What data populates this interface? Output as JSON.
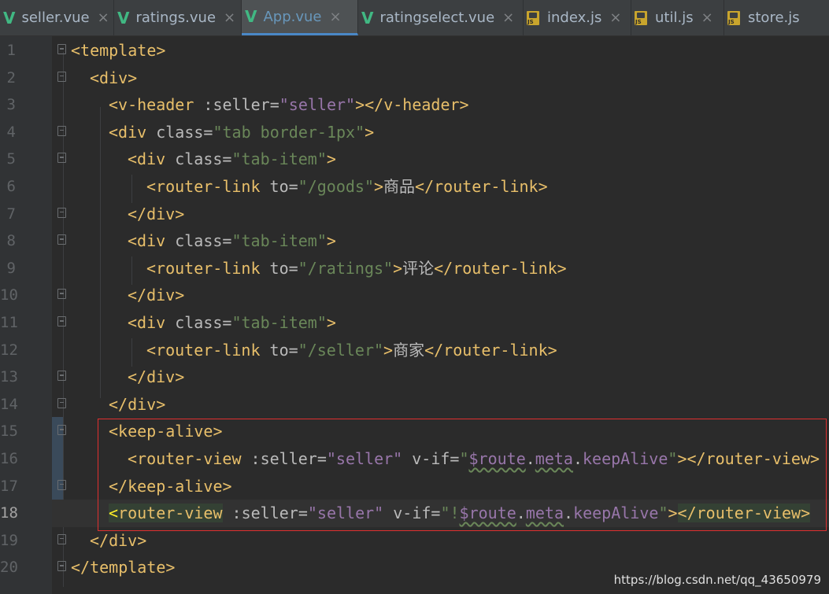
{
  "tabs": [
    {
      "label": "seller.vue",
      "icon": "vue-icon",
      "active": false
    },
    {
      "label": "ratings.vue",
      "icon": "vue-icon",
      "active": false
    },
    {
      "label": "App.vue",
      "icon": "vue-icon",
      "active": true
    },
    {
      "label": "ratingselect.vue",
      "icon": "vue-icon",
      "active": false
    },
    {
      "label": "index.js",
      "icon": "js-icon",
      "active": false
    },
    {
      "label": "util.js",
      "icon": "js-icon",
      "active": false
    },
    {
      "label": "store.js",
      "icon": "js-icon",
      "active": false
    }
  ],
  "close_glyph": "×",
  "vue_glyph": "V",
  "line_numbers": [
    "1",
    "2",
    "3",
    "4",
    "5",
    "6",
    "7",
    "8",
    "9",
    "10",
    "11",
    "12",
    "13",
    "14",
    "15",
    "16",
    "17",
    "18",
    "19",
    "20"
  ],
  "code": {
    "l1_tag": "<template>",
    "l2_tag": "<div>",
    "l3_open": "<v-header",
    "l3_attr": " :seller=",
    "l3_val": "\"seller\"",
    "l3_close": "></v-header>",
    "l4_open": "<div",
    "l4_attr": " class=",
    "l4_val": "\"tab border-1px\"",
    "l4_close": ">",
    "l5_open": "<div",
    "l5_attr": " class=",
    "l5_val": "\"tab-item\"",
    "l5_close": ">",
    "l6_open": "<router-link",
    "l6_attr": " to=",
    "l6_val": "\"/goods\"",
    "l6_gt": ">",
    "l6_text": "商品",
    "l6_close": "</router-link>",
    "l7_tag": "</div>",
    "l8_open": "<div",
    "l8_attr": " class=",
    "l8_val": "\"tab-item\"",
    "l8_close": ">",
    "l9_open": "<router-link",
    "l9_attr": " to=",
    "l9_val": "\"/ratings\"",
    "l9_gt": ">",
    "l9_text": "评论",
    "l9_close": "</router-link>",
    "l10_tag": "</div>",
    "l11_open": "<div",
    "l11_attr": " class=",
    "l11_val": "\"tab-item\"",
    "l11_close": ">",
    "l12_open": "<router-link",
    "l12_attr": " to=",
    "l12_val": "\"/seller\"",
    "l12_gt": ">",
    "l12_text": "商家",
    "l12_close": "</router-link>",
    "l13_tag": "</div>",
    "l14_tag": "</div>",
    "l15_tag": "<keep-alive>",
    "l16_open": "<router-view",
    "l16_attr1": " :seller=",
    "l16_val1": "\"seller\"",
    "l16_attr2": " v-if=",
    "l16_q1": "\"",
    "l16_route": "$route",
    "l16_dot1": ".",
    "l16_meta": "meta",
    "l16_dot2": ".",
    "l16_keep": "keepAlive",
    "l16_q2": "\"",
    "l16_close": "></router-view>",
    "l17_tag": "</keep-alive>",
    "l18_lt": "<",
    "l18_name": "router-view",
    "l18_attr1": " :seller=",
    "l18_val1": "\"seller\"",
    "l18_attr2": " v-if=",
    "l18_q1": "\"!",
    "l18_route": "$route",
    "l18_dot1": ".",
    "l18_meta": "meta",
    "l18_dot2": ".",
    "l18_keep": "keepAlive",
    "l18_q2": "\"",
    "l18_gt": ">",
    "l18_close": "</router-view>",
    "l19_tag": "</div>",
    "l20_tag": "</template>"
  },
  "watermark": "https://blog.csdn.net/qq_43650979",
  "colors": {
    "tag": "#e8bf6a",
    "attr": "#bababa",
    "string": "#6a8759",
    "var": "#9876aa",
    "highlight_box": "#e03030"
  }
}
